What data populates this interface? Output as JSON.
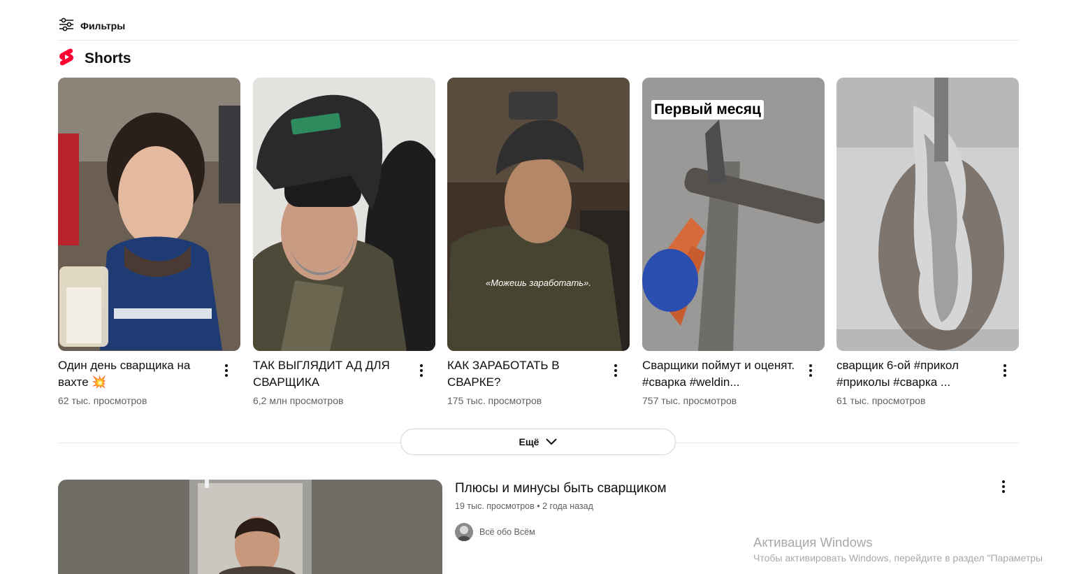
{
  "filters": {
    "label": "Фильтры"
  },
  "shorts_section": {
    "title": "Shorts"
  },
  "shorts": [
    {
      "title": "Один день сварщика на вахте 💥",
      "views": "62 тыс. просмотров"
    },
    {
      "title": "ТАК ВЫГЛЯДИТ АД ДЛЯ СВАРЩИКА",
      "views": "6,2 млн просмотров"
    },
    {
      "title": "КАК ЗАРАБОТАТЬ В СВАРКЕ?",
      "views": "175 тыс. просмотров",
      "overlay_text": "«Можешь заработать»."
    },
    {
      "title": "Сварщики поймут и оценят. #сварка #weldin...",
      "views": "757 тыс. просмотров",
      "overlay_text": "Первый месяц"
    },
    {
      "title": "сварщик 6-ой #прикол #приколы #сварка ...",
      "views": "61 тыс. просмотров"
    }
  ],
  "more": {
    "label": "Ещё"
  },
  "video": {
    "title": "Плюсы и минусы быть сварщиком",
    "views": "19 тыс. просмотров",
    "separator": "•",
    "age": "2 года назад",
    "channel": "Всё обо Всём"
  },
  "watermark": {
    "line1": "Активация Windows",
    "line2": "Чтобы активировать Windows, перейдите в раздел \"Параметры"
  },
  "colors": {
    "shorts_red": "#ff0033",
    "text": "#0f0f0f",
    "secondary": "#606060",
    "divider": "#e5e5e5"
  }
}
